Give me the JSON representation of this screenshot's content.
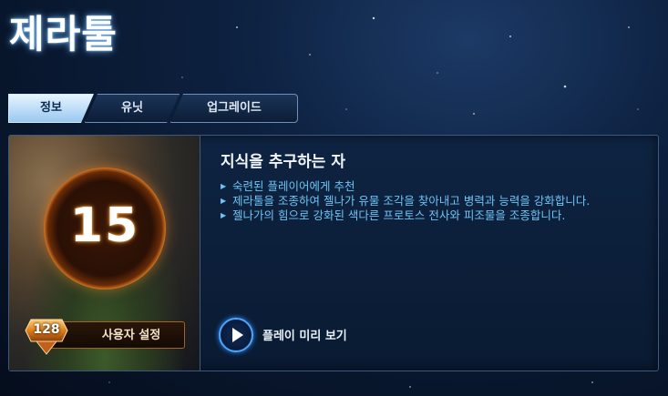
{
  "hero": {
    "name": "제라툴"
  },
  "tabs": [
    {
      "label": "정보",
      "active": true
    },
    {
      "label": "유닛",
      "active": false
    },
    {
      "label": "업그레이드",
      "active": false
    }
  ],
  "level": {
    "value": "15",
    "badge_value": "128",
    "settings_label": "사용자 설정"
  },
  "info": {
    "heading": "지식을 추구하는 자",
    "bullets": [
      "숙련된 플레이어에게 추천",
      "제라툴을 조종하여 젤나가 유물 조각을 찾아내고 병력과 능력을 강화합니다.",
      "젤나가의 힘으로 강화된 색다른 프로토스 전사와 피조물을 조종합니다."
    ]
  },
  "preview": {
    "label": "플레이 미리 보기",
    "icon": "play-icon"
  },
  "colors": {
    "accent": "#4aa6ff",
    "text_blue": "#6ec4f4",
    "level_orange": "#f08a28"
  }
}
